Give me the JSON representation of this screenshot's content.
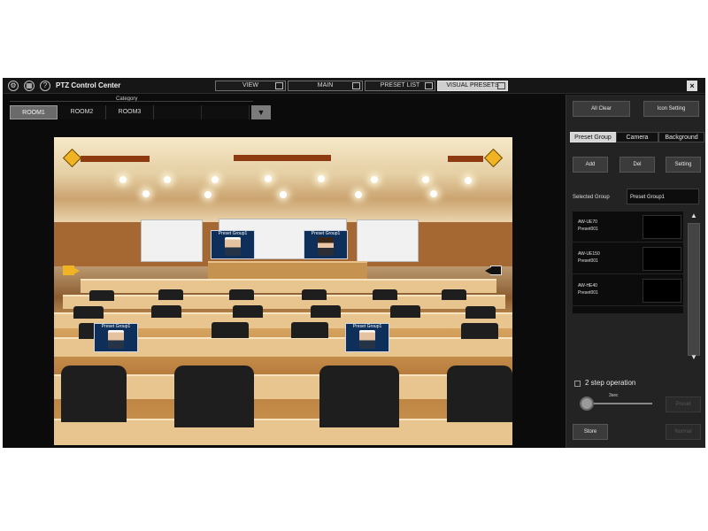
{
  "window": {
    "title": "PTZ Control Center",
    "icons": [
      "settings-icon",
      "camera-list-icon",
      "help-icon"
    ],
    "close": "×"
  },
  "tabs": [
    {
      "label": "VIEW",
      "active": false
    },
    {
      "label": "MAIN",
      "active": false
    },
    {
      "label": "PRESET LIST",
      "active": false
    },
    {
      "label": "VISUAL PRESETS",
      "active": true
    }
  ],
  "category": {
    "label": "Category",
    "rooms": [
      "ROOM1",
      "ROOM2",
      "ROOM3"
    ],
    "selected": "ROOM1",
    "dropdown": "▼"
  },
  "scene": {
    "presets": [
      {
        "label": "Preset Group1",
        "person": "male"
      },
      {
        "label": "Preset Group1",
        "person": "female"
      },
      {
        "label": "Preset Group1",
        "person": "male"
      },
      {
        "label": "Preset Group1",
        "person": "male"
      }
    ]
  },
  "right_panel": {
    "all_clear": "All Clear",
    "icon_setting": "Icon Setting",
    "modes": [
      "Preset Group",
      "Camera",
      "Background"
    ],
    "active_mode": "Preset Group",
    "add": "Add",
    "del": "Del",
    "setting": "Setting",
    "selected_group_label": "Selected Group",
    "selected_group_value": "Preset Group1",
    "list": [
      {
        "camera": "AW-UE70",
        "preset": "Preset001"
      },
      {
        "camera": "AW-UE150",
        "preset": "Preset001"
      },
      {
        "camera": "AW-HE40",
        "preset": "Preset001"
      }
    ],
    "scroll_up": "▲",
    "scroll_down": "▼",
    "two_step_label": "2 step operation",
    "speed_value": "3sec",
    "preset_btn": "Preset",
    "store_btn": "Store",
    "normal_btn": "Normal",
    "colors": {
      "accent": "#f0b323",
      "preset_badge": "#0d2f5a"
    }
  }
}
